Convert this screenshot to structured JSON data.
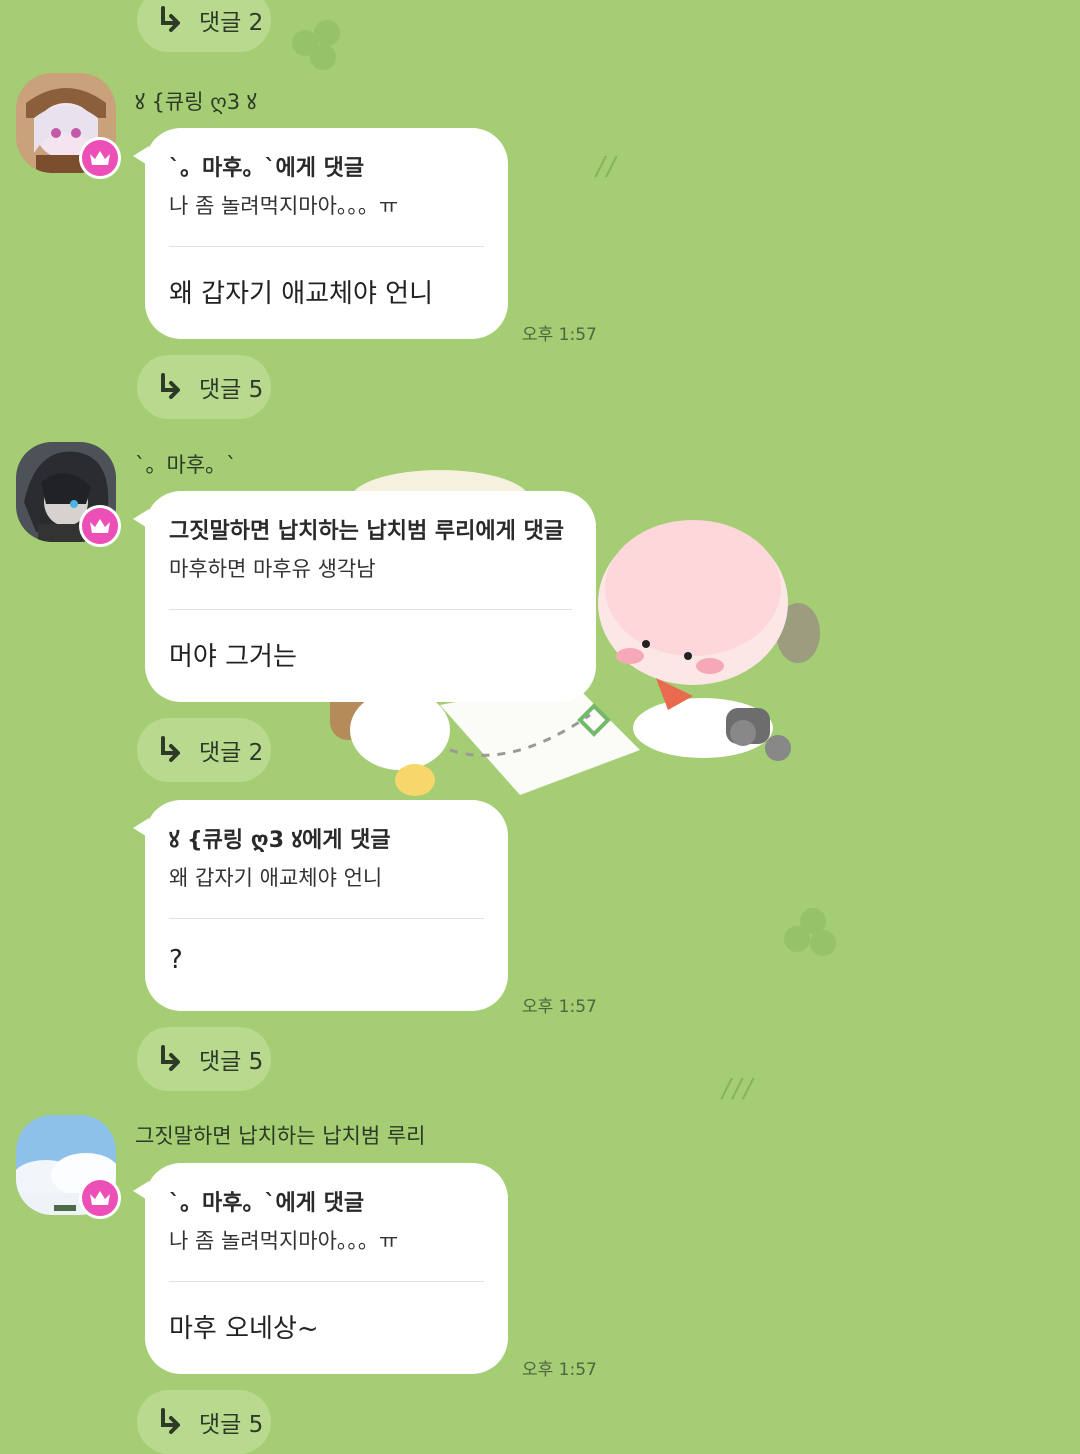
{
  "threads": [
    {
      "reply_top": {
        "label": "댓글 2"
      }
    },
    {
      "sender": "ꙋ {큐링 ღ3 ꙋ",
      "quote_head": "`。마후。`에게 댓글",
      "quote_body": "나 좀 놀려먹지마아。。。ㅠ",
      "message": "왜 갑자기 애교체야 언니",
      "time": "오후 1:57",
      "reply": "댓글 5"
    },
    {
      "sender": "`。마후。`",
      "quote_head": "그짓말하면 납치하는 납치범 루리에게 댓글",
      "quote_body": "마후하면 마후유 생각남",
      "message": "머야 그거는",
      "reply": "댓글 2"
    },
    {
      "quote_head": "ꙋ {큐링 ღ3 ꙋ에게 댓글",
      "quote_body": "왜 갑자기 애교체야 언니",
      "message": "?",
      "time": "오후 1:57",
      "reply": "댓글 5"
    },
    {
      "sender": "그짓말하면 납치하는 납치범 루리",
      "quote_head": "`。마후。`에게 댓글",
      "quote_body": "나 좀 놀려먹지마아。。。ㅠ",
      "message": "마후 오네상~",
      "time": "오후 1:57",
      "reply": "댓글 5"
    }
  ],
  "colors": {
    "background": "#a4cd74",
    "badge": "#ec4fb6",
    "pill": "#b9da8e"
  },
  "icons": {
    "reply": "reply-arrow-icon",
    "badge": "crown-icon"
  }
}
